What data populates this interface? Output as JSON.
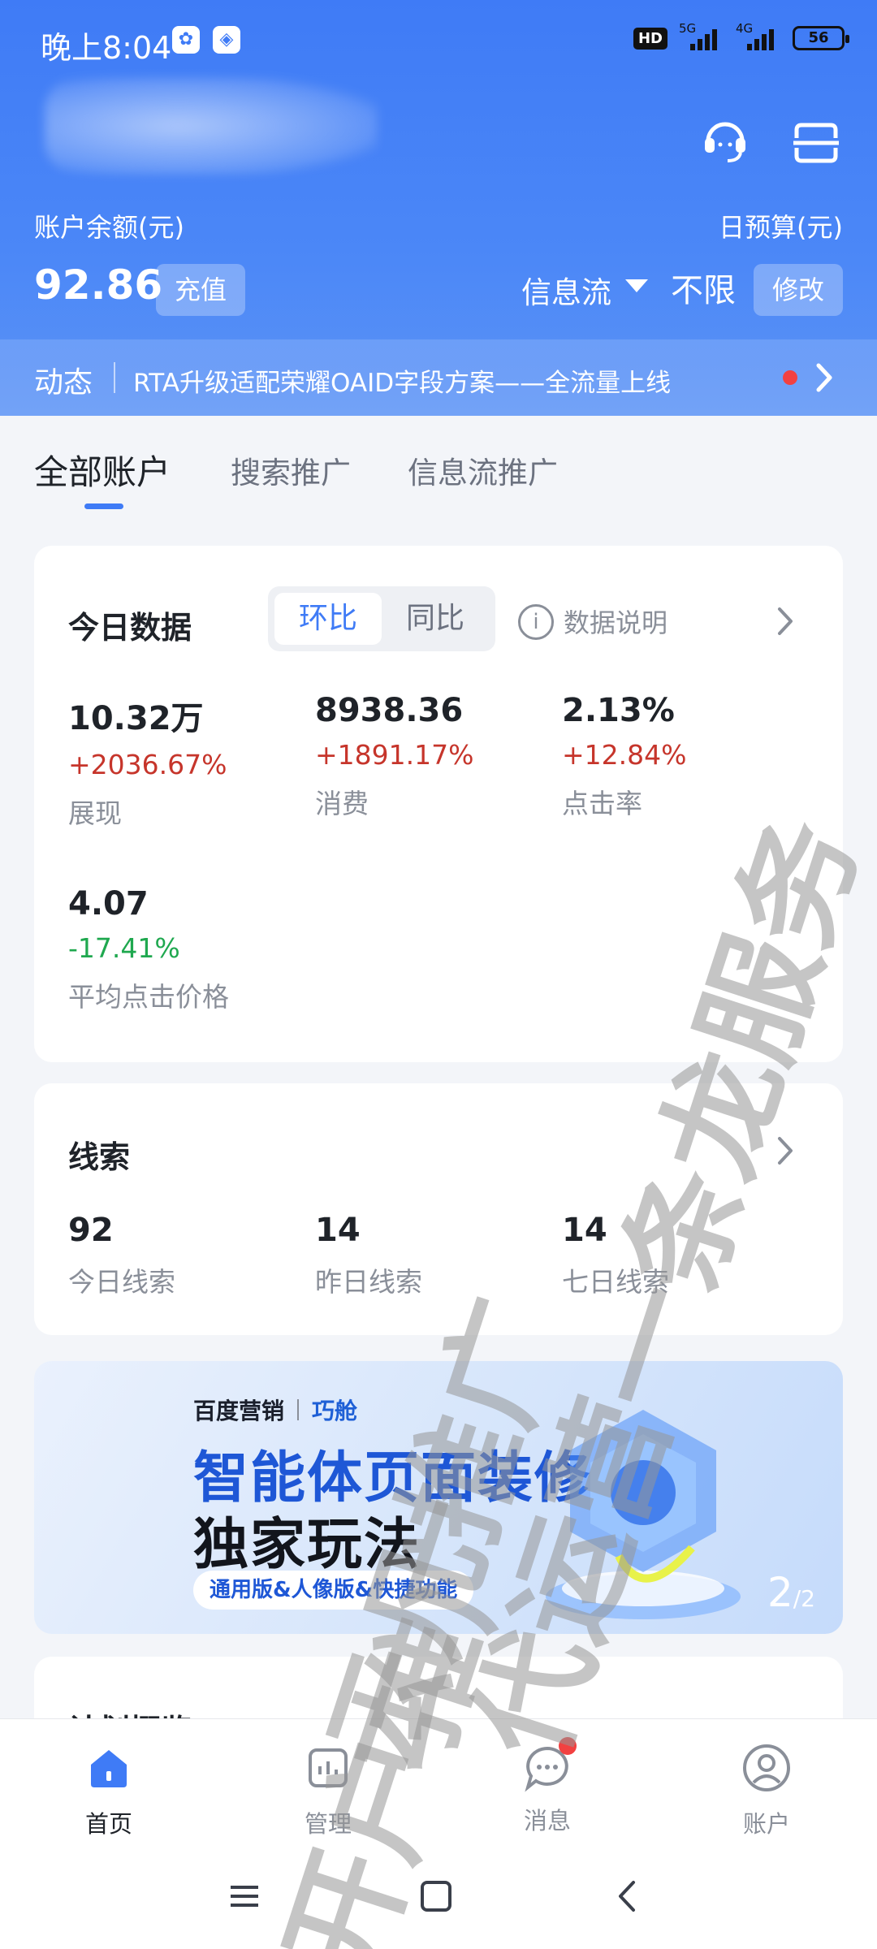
{
  "status_bar": {
    "time": "晚上8:04",
    "hd_badge": "HD",
    "signal_1": "5G",
    "signal_2": "4G",
    "battery": "56"
  },
  "header": {
    "balance_label": "账户余额(元)",
    "balance_value": "92.86",
    "recharge_label": "充值",
    "budget_label": "日预算(元)",
    "feed_select_label": "信息流",
    "budget_value": "不限",
    "modify_label": "修改",
    "news_tag": "动态",
    "news_text": "RTA升级适配荣耀OAID字段方案——全流量上线"
  },
  "tabs": [
    {
      "label": "全部账户"
    },
    {
      "label": "搜索推广"
    },
    {
      "label": "信息流推广"
    }
  ],
  "today": {
    "title": "今日数据",
    "seg_active": "环比",
    "seg_other": "同比",
    "info_label": "数据说明",
    "metrics": [
      {
        "value": "10.32万",
        "change": "+2036.67%",
        "label": "展现",
        "trend": "up"
      },
      {
        "value": "8938.36",
        "change": "+1891.17%",
        "label": "消费",
        "trend": "up"
      },
      {
        "value": "2.13%",
        "change": "+12.84%",
        "label": "点击率",
        "trend": "up"
      },
      {
        "value": "4.07",
        "change": "-17.41%",
        "label": "平均点击价格",
        "trend": "down"
      }
    ]
  },
  "leads": {
    "title": "线索",
    "items": [
      {
        "value": "92",
        "label": "今日线索"
      },
      {
        "value": "14",
        "label": "昨日线索"
      },
      {
        "value": "14",
        "label": "七日线索"
      }
    ]
  },
  "banner": {
    "brand_1": "百度营销",
    "brand_2": "巧舱",
    "title_1": "智能体页面装修",
    "title_2": "独家玩法",
    "pill": "通用版&人像版&快捷功能",
    "page_current": "2",
    "page_total": "/2"
  },
  "plan": {
    "title": "计划概览"
  },
  "bottom_nav": [
    {
      "label": "首页",
      "icon": "home-icon"
    },
    {
      "label": "管理",
      "icon": "manage-icon"
    },
    {
      "label": "消息",
      "icon": "message-icon"
    },
    {
      "label": "账户",
      "icon": "user-icon"
    }
  ],
  "watermark": {
    "line_1": "开户推广",
    "line_2": "云凡推广",
    "line_3": "代运营一条龙服务"
  },
  "colors": {
    "brand_blue": "#3f7bf6",
    "up_red": "#c6352b",
    "down_green": "#1fa84f",
    "notification_red": "#f24141"
  }
}
